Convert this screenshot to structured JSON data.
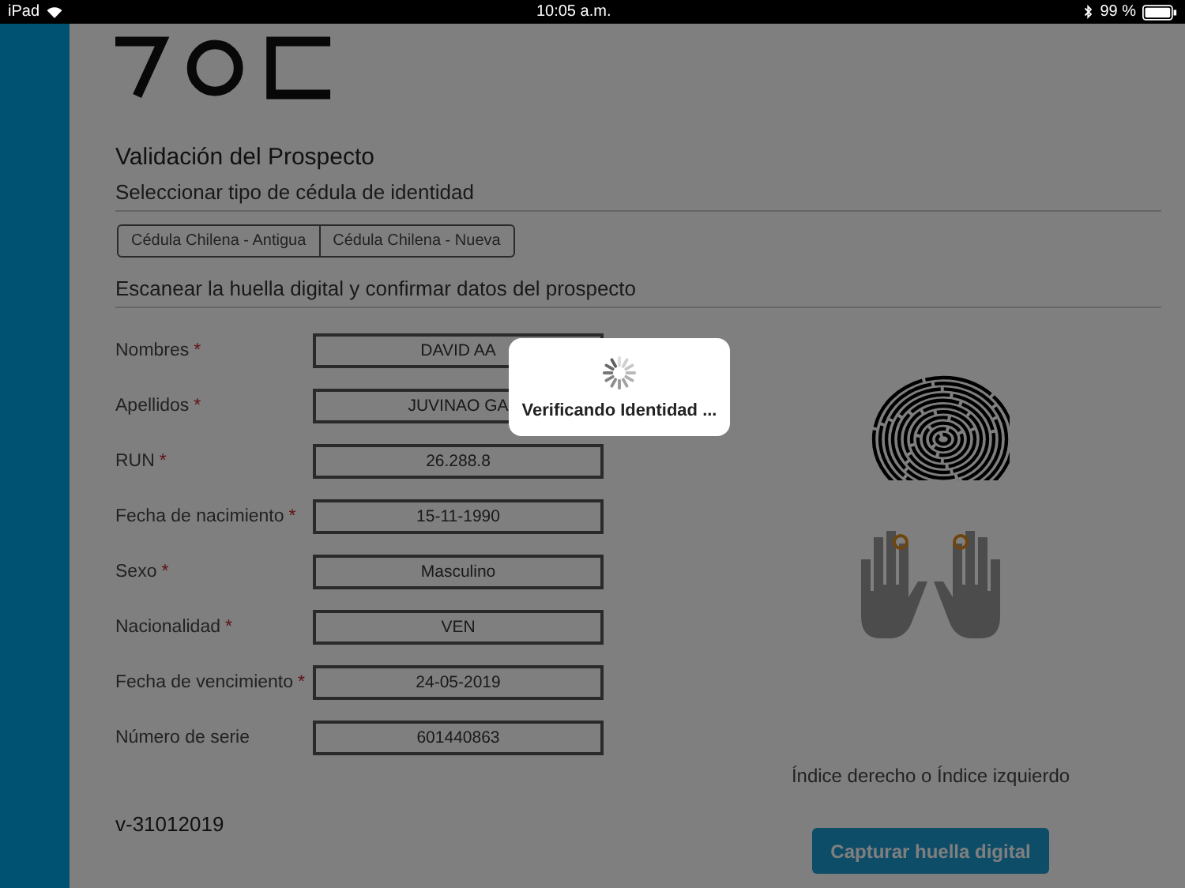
{
  "status_bar": {
    "device": "iPad",
    "time": "10:05 a.m.",
    "battery": "99 %"
  },
  "title": "Validación del Prospecto",
  "id_type": {
    "heading": "Seleccionar tipo de cédula de identidad",
    "options": [
      {
        "label": "Cédula Chilena - Antigua",
        "selected": false
      },
      {
        "label": "Cédula Chilena - Nueva",
        "selected": false
      }
    ]
  },
  "scan": {
    "heading": "Escanear la huella digital y confirmar datos del prospecto",
    "fields": [
      {
        "label": "Nombres",
        "mark": "*",
        "value": "DAVID AA"
      },
      {
        "label": "Apellidos",
        "mark": "*",
        "value": "JUVINAO GA"
      },
      {
        "label": "RUN",
        "mark": "*",
        "value": "26.288.8"
      },
      {
        "label": "Fecha de nacimiento",
        "mark": "*",
        "value": "15-11-1990"
      },
      {
        "label": "Sexo",
        "mark": "*",
        "value": "Masculino"
      },
      {
        "label": "Nacionalidad",
        "mark": "*",
        "value": "VEN"
      },
      {
        "label": "Fecha de vencimiento",
        "mark": "*",
        "value": "24-05-2019"
      },
      {
        "label": "Número de serie",
        "value": "601440863"
      }
    ],
    "finger_hint": "Índice derecho o Índice izquierdo",
    "capture_button": "Capturar huella digital"
  },
  "version": "v-31012019",
  "loading": {
    "visible": true,
    "message": "Verificando Identidad ..."
  }
}
